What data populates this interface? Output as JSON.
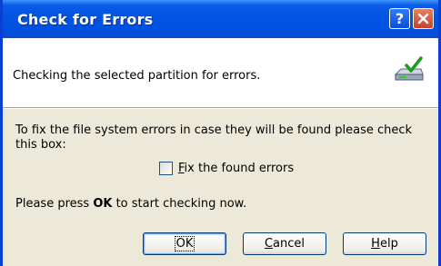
{
  "dialog": {
    "title": "Check for Errors",
    "help_glyph": "?",
    "header_text": "Checking the selected partition for errors.",
    "fix_instruction": "To fix the file system errors in case they will be found please check this box:",
    "checkbox": {
      "label_access": "F",
      "label_rest": "ix the found errors",
      "checked": false
    },
    "press_prefix": "Please press ",
    "press_ok": "OK",
    "press_suffix": " to start checking now.",
    "buttons": {
      "ok": "OK",
      "cancel_access": "C",
      "cancel_rest": "ancel",
      "help_access": "H",
      "help_rest": "elp"
    },
    "icons": [
      "help-icon",
      "close-icon",
      "disk-check-icon"
    ],
    "colors": {
      "titlebar": "#0054e3",
      "border": "#0a3fd4",
      "body": "#ece9d8",
      "close": "#c8432a"
    }
  }
}
